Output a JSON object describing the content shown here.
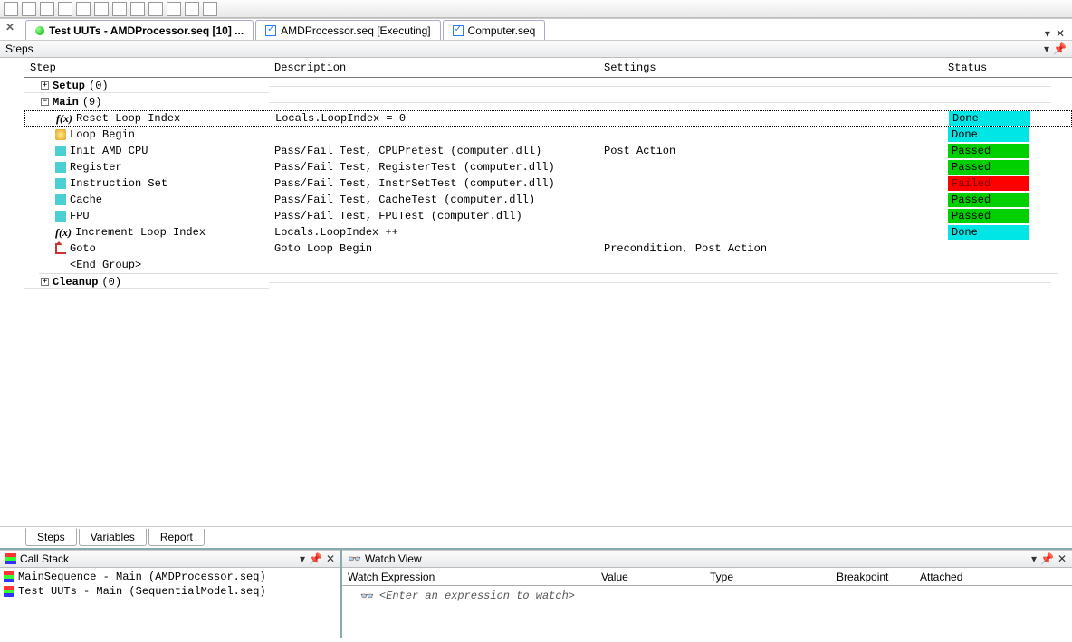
{
  "toolbar_icons": [
    "a",
    "b",
    "c",
    "d",
    "e",
    "f",
    "g",
    "h",
    "i",
    "j",
    "k",
    "l",
    "m",
    "n",
    "o",
    "p"
  ],
  "tabs": {
    "main": {
      "label": "Test UUTs - AMDProcessor.seq [10]  ..."
    },
    "exec": {
      "label": "AMDProcessor.seq [Executing]"
    },
    "comp": {
      "label": "Computer.seq"
    }
  },
  "pane_title": "Steps",
  "columns": {
    "step": "Step",
    "desc": "Description",
    "settings": "Settings",
    "status": "Status"
  },
  "groups": {
    "setup": {
      "name": "Setup",
      "count": "(0)",
      "expanded": false
    },
    "main": {
      "name": "Main",
      "count": "(9)",
      "expanded": true
    },
    "cleanup": {
      "name": "Cleanup",
      "count": "(0)",
      "expanded": false
    }
  },
  "steps": [
    {
      "icon": "fx",
      "name": "Reset Loop Index",
      "desc": "Locals.LoopIndex = 0",
      "settings": "",
      "status": "Done",
      "scl": "s-done",
      "sel": true
    },
    {
      "icon": "loop",
      "name": "Loop Begin",
      "desc": "",
      "settings": "",
      "status": "Done",
      "scl": "s-done"
    },
    {
      "icon": "teal",
      "name": "Init AMD CPU",
      "desc": "Pass/Fail Test,  CPUPretest (computer.dll)",
      "settings": "Post Action",
      "status": "Passed",
      "scl": "s-passed"
    },
    {
      "icon": "teal",
      "name": "Register",
      "desc": "Pass/Fail Test,  RegisterTest (computer.dll)",
      "settings": "",
      "status": "Passed",
      "scl": "s-passed"
    },
    {
      "icon": "teal",
      "name": "Instruction Set",
      "desc": "Pass/Fail Test,  InstrSetTest (computer.dll)",
      "settings": "",
      "status": "Failed",
      "scl": "s-failed"
    },
    {
      "icon": "teal",
      "name": "Cache",
      "desc": "Pass/Fail Test,  CacheTest (computer.dll)",
      "settings": "",
      "status": "Passed",
      "scl": "s-passed"
    },
    {
      "icon": "teal",
      "name": "FPU",
      "desc": "Pass/Fail Test,  FPUTest (computer.dll)",
      "settings": "",
      "status": "Passed",
      "scl": "s-passed"
    },
    {
      "icon": "fx",
      "name": "Increment Loop Index",
      "desc": "Locals.LoopIndex ++",
      "settings": "",
      "status": "Done",
      "scl": "s-done"
    },
    {
      "icon": "goto",
      "name": "Goto",
      "desc": "Goto Loop Begin",
      "settings": "Precondition, Post Action",
      "status": "",
      "ptr": true
    },
    {
      "icon": "none",
      "name": "<End Group>",
      "desc": "",
      "settings": "",
      "status": ""
    }
  ],
  "bottom_tabs": {
    "steps": "Steps",
    "variables": "Variables",
    "report": "Report"
  },
  "callstack": {
    "title": "Call Stack",
    "rows": [
      "MainSequence - Main (AMDProcessor.seq)",
      "Test UUTs - Main (SequentialModel.seq)"
    ]
  },
  "watch": {
    "title": "Watch View",
    "columns": {
      "expr": "Watch Expression",
      "value": "Value",
      "type": "Type",
      "bp": "Breakpoint",
      "att": "Attached"
    },
    "placeholder": "<Enter an expression to watch>"
  }
}
